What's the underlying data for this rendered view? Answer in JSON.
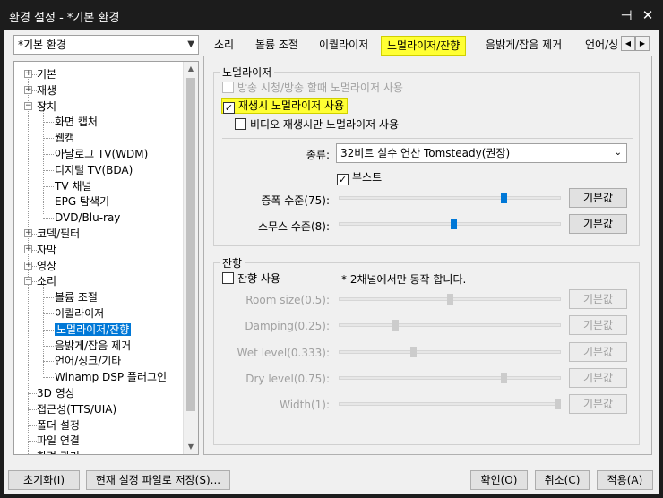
{
  "window": {
    "title": "환경 설정 - *기본 환경",
    "pin_icon": "pin-icon",
    "close_icon": "close-icon"
  },
  "profile": {
    "selected": "*기본 환경"
  },
  "tree": {
    "items": [
      {
        "label": "기본",
        "expander": "+"
      },
      {
        "label": "재생",
        "expander": "+"
      },
      {
        "label": "장치",
        "expander": "−"
      },
      {
        "label": "화면 캡처"
      },
      {
        "label": "웹캠"
      },
      {
        "label": "아날로그 TV(WDM)"
      },
      {
        "label": "디지털 TV(BDA)"
      },
      {
        "label": "TV 채널"
      },
      {
        "label": "EPG 탐색기"
      },
      {
        "label": "DVD/Blu-ray"
      },
      {
        "label": "코덱/필터",
        "expander": "+"
      },
      {
        "label": "자막",
        "expander": "+"
      },
      {
        "label": "영상",
        "expander": "+"
      },
      {
        "label": "소리",
        "expander": "−"
      },
      {
        "label": "볼륨 조절"
      },
      {
        "label": "이퀄라이저"
      },
      {
        "label": "노멀라이저/잔향"
      },
      {
        "label": "음밝게/잡음 제거"
      },
      {
        "label": "언어/싱크/기타"
      },
      {
        "label": "Winamp DSP 플러그인"
      },
      {
        "label": "3D 영상"
      },
      {
        "label": "접근성(TTS/UIA)"
      },
      {
        "label": "폴더 설정"
      },
      {
        "label": "파일 연결"
      },
      {
        "label": "환경 관리"
      }
    ]
  },
  "tabs": [
    "소리",
    "볼륨 조절",
    "이퀄라이저",
    "노멀라이저/잔향",
    "음밝게/잡음 제거",
    "언어/싱"
  ],
  "normalizer": {
    "group_title": "노멀라이저",
    "broadcast_check": "방송 시청/방송 할때 노멀라이저 사용",
    "playback_check": "재생시 노멀라이저 사용",
    "video_only_check": "비디오 재생시만 노멀라이저 사용",
    "type_label": "종류:",
    "type_value": "32비트 실수 연산 Tomsteady(권장)",
    "boost_check": "부스트",
    "amp_label": "증폭 수준(75):",
    "amp_level": 0.75,
    "source_label": "스무스 수준(8):",
    "source_level": 0.52,
    "default_label": "기본값"
  },
  "reverb": {
    "group_title": "잔향",
    "use_check": "잔향 사용",
    "note": "* 2채널에서만 동작 합니다.",
    "params": [
      {
        "label": "Room size(0.5):",
        "level": 0.5
      },
      {
        "label": "Damping(0.25):",
        "level": 0.25
      },
      {
        "label": "Wet level(0.333):",
        "level": 0.333
      },
      {
        "label": "Dry level(0.75):",
        "level": 0.75
      },
      {
        "label": "Width(1):",
        "level": 1.0
      }
    ],
    "default_label": "기본값"
  },
  "footer": {
    "reset": "초기화(I)",
    "save_current": "현재 설정 파일로 저장(S)...",
    "ok": "확인(O)",
    "cancel": "취소(C)",
    "apply": "적용(A)"
  }
}
